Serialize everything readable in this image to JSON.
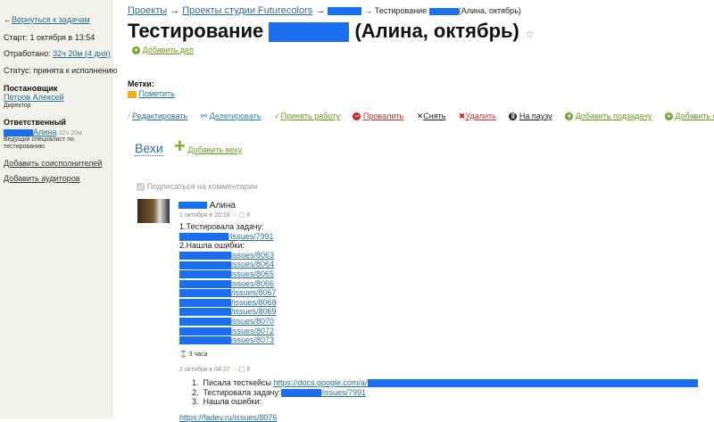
{
  "sidebar": {
    "back": "Вернуться к задачам",
    "start": "Старт: 1 октября в 13:54",
    "worked_label": "Отработано:",
    "worked_value": "32ч 20м (4 дня)",
    "status": "Статус: принята к исполнению",
    "author_heading": "Постановщик",
    "author_name": "Петров Алексей",
    "author_role": "Директор",
    "resp_heading": "Ответственный",
    "resp_name": "Алина",
    "resp_time": "32ч 20м",
    "resp_role_1": "Ведущий специалист по",
    "resp_role_2": "тестированию",
    "add_coexec": "Добавить соисполнителей",
    "add_auditors": "Добавить аудиторов"
  },
  "breadcrumb": {
    "projects": "Проекты",
    "studio": "Проекты студии Futurecolors",
    "current_pre": "Тестирование",
    "current_post": "(Алина, октябрь)"
  },
  "title": {
    "pre": "Тестирование",
    "post": "(Алина, октябрь)"
  },
  "add_case": "Добавить дел",
  "tags": {
    "label": "Метки:",
    "mark": "Пометить"
  },
  "actions": {
    "edit": "Редактировать",
    "delegate": "Делегировать",
    "accept": "Принять работу",
    "fail": "Провалить",
    "remove": "Снять",
    "delete": "Удалить",
    "pause": "На паузу",
    "add_subtask": "Добавить подзадачу",
    "add_operation": "Добавить операцию"
  },
  "milestones": {
    "title": "Вехи",
    "add": "Добавить веху"
  },
  "subscribe": "Подписаться на комментарии",
  "comment1": {
    "author": "Алина",
    "date": "1 октября в 20:18",
    "line1": "1.Тестировала задачу:",
    "issue_first": "/issues/7991",
    "line2": "2.Нашла ошибки:",
    "issues": [
      "issues/8063",
      "issues/8064",
      "issues/8065",
      "issues/8066",
      "/issues/8067",
      "/issues/8068",
      "/issues/8069",
      "issues/8070",
      "issues/8072",
      "issues/8073"
    ],
    "time_spent": "3 часа"
  },
  "comment2": {
    "date": "2 октября в 04:27",
    "items": [
      "Писала тесткейсы",
      "Тестировала задачу:",
      "Нашла ошибки:"
    ],
    "link1": "https://docs.google.com/a/",
    "link2": "/issues/7991",
    "trailing": "https://fadev.ru/issues/8076"
  }
}
